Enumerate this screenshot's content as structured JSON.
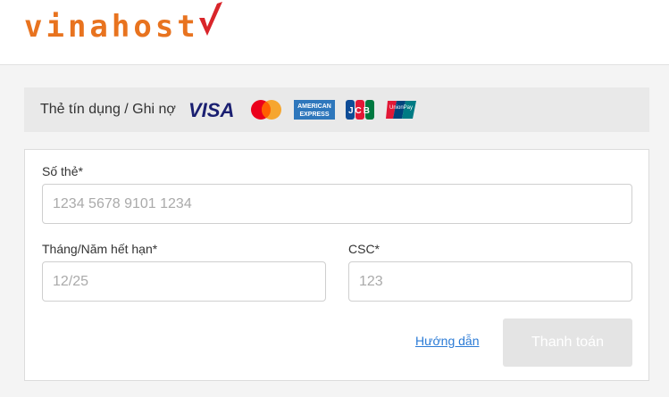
{
  "brand": {
    "logo_text": "vinahost"
  },
  "payment_header": {
    "title": "Thẻ tín dụng / Ghi nợ",
    "brands": {
      "visa": "VISA",
      "amex_top": "AMERICAN",
      "amex_bottom": "EXPRESS",
      "jcb": "JCB",
      "unionpay": "UnionPay"
    }
  },
  "form": {
    "card_number": {
      "label": "Số thẻ*",
      "placeholder": "1234 5678 9101 1234",
      "value": ""
    },
    "expiry": {
      "label": "Tháng/Năm hết hạn*",
      "placeholder": "12/25",
      "value": ""
    },
    "csc": {
      "label": "CSC*",
      "placeholder": "123",
      "value": ""
    },
    "help_link": "Hướng dẫn",
    "pay_button": "Thanh toán"
  },
  "colors": {
    "brand_orange": "#e8731f",
    "brand_red": "#d9252a",
    "link": "#2b7bd6",
    "disabled_button": "#e4e4e4"
  }
}
